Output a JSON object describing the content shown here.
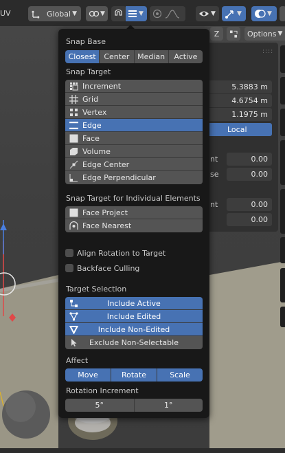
{
  "header": {
    "uv_label": "UV",
    "orientation_label": "Global",
    "options_label": "Options",
    "axis_z_label": "Z"
  },
  "side_panel": {
    "values": [
      "5.3883 m",
      "4.6754 m",
      "1.1975 m"
    ],
    "local_label": "Local",
    "row_labels": [
      "nt",
      "se",
      "nt"
    ],
    "zero_values": [
      "0.00",
      "0.00",
      "0.00",
      "0.00"
    ]
  },
  "popover": {
    "snap_base": {
      "title": "Snap Base",
      "options": [
        "Closest",
        "Center",
        "Median",
        "Active"
      ],
      "selected": "Closest"
    },
    "snap_target": {
      "title": "Snap Target",
      "items": [
        {
          "label": "Increment",
          "icon": "increment-icon",
          "on": false
        },
        {
          "label": "Grid",
          "icon": "grid-icon",
          "on": false
        },
        {
          "label": "Vertex",
          "icon": "vertex-icon",
          "on": false
        },
        {
          "label": "Edge",
          "icon": "edge-icon",
          "on": true
        },
        {
          "label": "Face",
          "icon": "face-icon",
          "on": false
        },
        {
          "label": "Volume",
          "icon": "volume-icon",
          "on": false
        },
        {
          "label": "Edge Center",
          "icon": "edge-center-icon",
          "on": false
        },
        {
          "label": "Edge Perpendicular",
          "icon": "edge-perpendicular-icon",
          "on": false
        }
      ]
    },
    "individual": {
      "title": "Snap Target for Individual Elements",
      "items": [
        {
          "label": "Face Project",
          "icon": "face-project-icon"
        },
        {
          "label": "Face Nearest",
          "icon": "face-nearest-icon"
        }
      ]
    },
    "align_rotation": {
      "label": "Align Rotation to Target",
      "checked": false
    },
    "backface_culling": {
      "label": "Backface Culling",
      "checked": false
    },
    "target_selection": {
      "title": "Target Selection",
      "items": [
        {
          "label": "Include Active",
          "icon": "include-active-icon",
          "on": true
        },
        {
          "label": "Include Edited",
          "icon": "include-edited-icon",
          "on": true
        },
        {
          "label": "Include Non-Edited",
          "icon": "include-non-edited-icon",
          "on": true
        },
        {
          "label": "Exclude Non-Selectable",
          "icon": "cursor-icon",
          "on": false
        }
      ]
    },
    "affect": {
      "title": "Affect",
      "options": [
        "Move",
        "Rotate",
        "Scale"
      ]
    },
    "rotation_increment": {
      "title": "Rotation Increment",
      "values": [
        "5°",
        "1°"
      ]
    }
  },
  "colors": {
    "accent": "#4772b3",
    "button": "#545454",
    "popover_bg": "#181818",
    "header_bg": "#2b2b2b"
  }
}
